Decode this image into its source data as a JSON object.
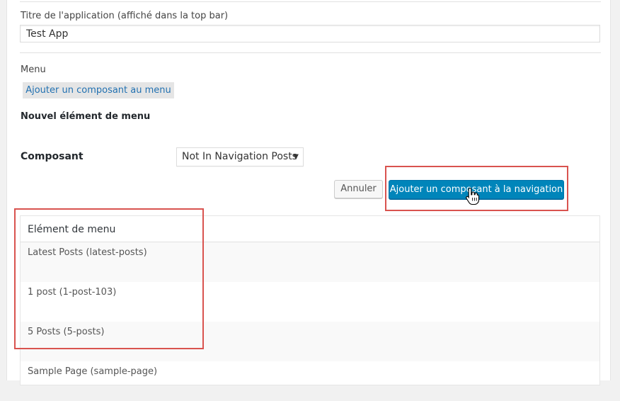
{
  "app_title_field": {
    "label": "Titre de l'application (affiché dans la top bar)",
    "value": "Test App"
  },
  "menu_section": {
    "label": "Menu",
    "add_component_button": "Ajouter un composant au menu",
    "new_item_heading": "Nouvel élément de menu"
  },
  "component_row": {
    "label": "Composant",
    "selected": "Not In Navigation Posts"
  },
  "actions": {
    "cancel": "Annuler",
    "add_to_navigation": "Ajouter un composant à la navigation"
  },
  "menu_table": {
    "header": "Elément de menu",
    "rows": [
      "Latest Posts (latest-posts)",
      "1 post (1-post-103)",
      "5 Posts (5-posts)",
      "Sample Page (sample-page)"
    ]
  },
  "colors": {
    "primary": "#0085ba",
    "highlight": "#d9534f",
    "link": "#2271b1"
  },
  "icons": [
    "dropdown-caret-icon",
    "hand-pointer-cursor-icon"
  ]
}
